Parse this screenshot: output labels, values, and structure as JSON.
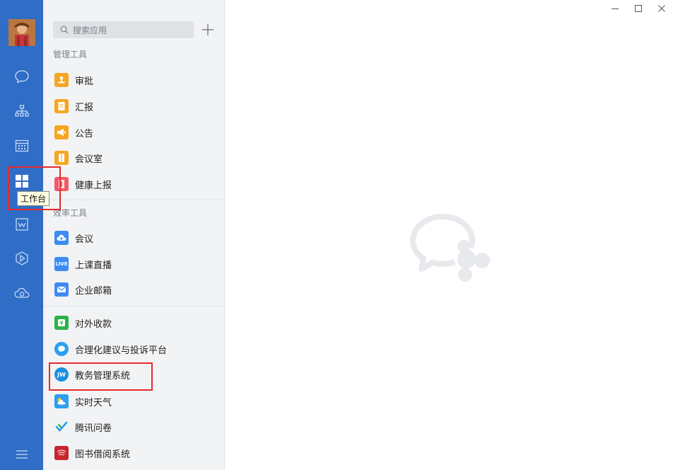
{
  "rail": {
    "icons": [
      "chat-icon",
      "org-chart-icon",
      "calendar-icon",
      "workbench-icon",
      "docs-icon",
      "box-icon",
      "cloud-icon",
      "menu-icon"
    ],
    "tooltip": "工作台",
    "accent": "#2f6dc6"
  },
  "search": {
    "placeholder": "搜索应用"
  },
  "sections": [
    {
      "title": "管理工具",
      "items": [
        {
          "label": "审批",
          "icon": "approval-icon",
          "color": "#f5a623"
        },
        {
          "label": "汇报",
          "icon": "report-icon",
          "color": "#f5a623"
        },
        {
          "label": "公告",
          "icon": "announcement-icon",
          "color": "#f5a623"
        },
        {
          "label": "会议室",
          "icon": "meeting-room-icon",
          "color": "#f5a623"
        },
        {
          "label": "健康上报",
          "icon": "health-report-icon",
          "color": "#f25a6a"
        }
      ]
    },
    {
      "title": "效率工具",
      "items": [
        {
          "label": "会议",
          "icon": "meeting-icon",
          "color": "#3d8bf2"
        },
        {
          "label": "上课直播",
          "icon": "live-icon",
          "color": "#3d8bf2",
          "badge": "LIVE"
        },
        {
          "label": "企业邮箱",
          "icon": "mail-icon",
          "color": "#3d8bf2"
        }
      ]
    },
    {
      "title": "",
      "items": [
        {
          "label": "对外收款",
          "icon": "payment-icon",
          "color": "#2bb24c"
        },
        {
          "label": "合理化建议与投诉平台",
          "icon": "feedback-icon",
          "color": "#2d9ff0"
        },
        {
          "label": "教务管理系统",
          "icon": "jw-icon",
          "color": "#1a8fe0",
          "badge": "JW"
        },
        {
          "label": "实时天气",
          "icon": "weather-icon",
          "color": "#2d9ff0"
        },
        {
          "label": "腾讯问卷",
          "icon": "survey-icon",
          "color": "#2d9ff0"
        },
        {
          "label": "图书借阅系统",
          "icon": "library-icon",
          "color": "#c8262f"
        }
      ]
    }
  ],
  "window": {
    "controls": [
      "minimize-icon",
      "maximize-icon",
      "close-icon"
    ]
  }
}
